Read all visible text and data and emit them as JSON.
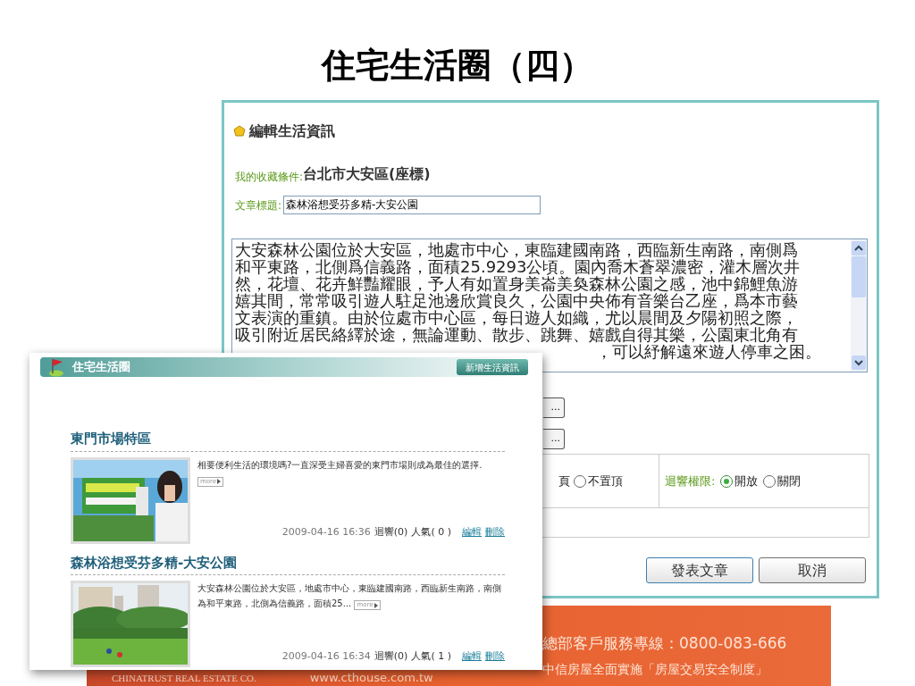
{
  "slide_title": "住宅生活圈（四）",
  "editor": {
    "heading": "編輯生活資訊",
    "favorite_label": "我的收藏條件:",
    "favorite_value": "台北市大安區(座標)",
    "title_label": "文章標題:",
    "title_value": "森林浴想受芬多精-大安公園",
    "body_lines": [
      "大安森林公園位於大安區，地處市中心，東臨建國南路，西臨新生南路，南側爲",
      "和平東路，北側爲信義路，面積25.9293公頃。園內喬木蒼翠濃密，灌木層次井",
      "然，花壇、花卉鮮豔耀眼，予人有如置身美崙美奐森林公園之感，池中錦鯉魚游",
      "嬉其間，常常吸引遊人駐足池邊欣賞良久，公園中央佈有音樂台乙座，爲本市藝",
      "文表演的重鎮。由於位處市中心區，每日遊人如織，尤以晨間及夕陽初照之際，",
      "吸引附近居民絡繹於途，無論運動、散步、跳舞、嬉戲自得其樂，公園東北角有"
    ],
    "body_tail": "，可以紓解遠來遊人停車之困。",
    "browse_buttons": [
      "...",
      "..."
    ],
    "pin_tail": "頁",
    "pin_options": [
      {
        "label": "不置頂",
        "selected": false
      }
    ],
    "reply_label": "迴響權限:",
    "reply_options": [
      {
        "label": "開放",
        "selected": true
      },
      {
        "label": "關閉",
        "selected": false
      }
    ],
    "buttons": [
      "發表文章",
      "取消"
    ]
  },
  "life_panel": {
    "title": "住宅生活圈",
    "add_button": "新增生活資訊",
    "posts": [
      {
        "title": "東門市場特區",
        "summary": "相要便利生活的環境嗎?一直深受主婦喜愛的東門市場則成為最佳的選擇.",
        "more": "more",
        "date": "2009-04-16 16:36",
        "replies": "迴響(0)",
        "views": "人氣( 0 )",
        "actions": [
          "編輯",
          "刪除"
        ],
        "kind": "promo"
      },
      {
        "title": "森林浴想受芬多精-大安公園",
        "summary": "大安森林公園位於大安區，地處市中心，東臨建國南路，西臨新生南路，南側為和平東路，北側為信義路，面積25...",
        "more": "more",
        "date": "2009-04-16 16:34",
        "replies": "迴響(0)",
        "views": "人氣( 1 )",
        "actions": [
          "編輯",
          "刪除"
        ],
        "kind": "park"
      }
    ]
  },
  "banner": {
    "company": "CHINATRUST REAL ESTATE CO.",
    "website": "www.cthouse.com.tw",
    "hotline": "總部客戶服務專線：0800-083-666",
    "slogan": "中信房屋全面實施「房屋交易安全制度」"
  }
}
